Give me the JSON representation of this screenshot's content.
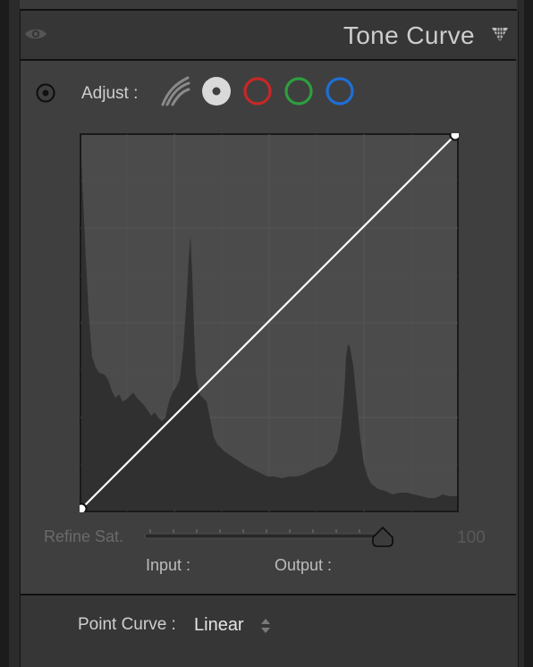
{
  "panel": {
    "title": "Tone Curve"
  },
  "adjust": {
    "label": "Adjust :",
    "channels": [
      {
        "name": "parametric",
        "icon": "parametric-curve-icon"
      },
      {
        "name": "rgb",
        "color": "#d9d9d9",
        "selected": true
      },
      {
        "name": "red",
        "color": "#c62828"
      },
      {
        "name": "green",
        "color": "#2e9e3e"
      },
      {
        "name": "blue",
        "color": "#1f6fd6"
      }
    ]
  },
  "curve": {
    "points": [
      {
        "input": 0,
        "output": 0
      },
      {
        "input": 255,
        "output": 255
      }
    ]
  },
  "refine": {
    "label": "Refine Sat.",
    "value": "100"
  },
  "io": {
    "input_label": "Input :",
    "output_label": "Output :"
  },
  "point_curve": {
    "label": "Point Curve :",
    "value": "Linear"
  },
  "colors": {
    "panel": "#363636",
    "inner": "#3f3f3f",
    "graph_bg": "#4a4a4a",
    "histogram": "#303030",
    "curve": "#ffffff"
  }
}
